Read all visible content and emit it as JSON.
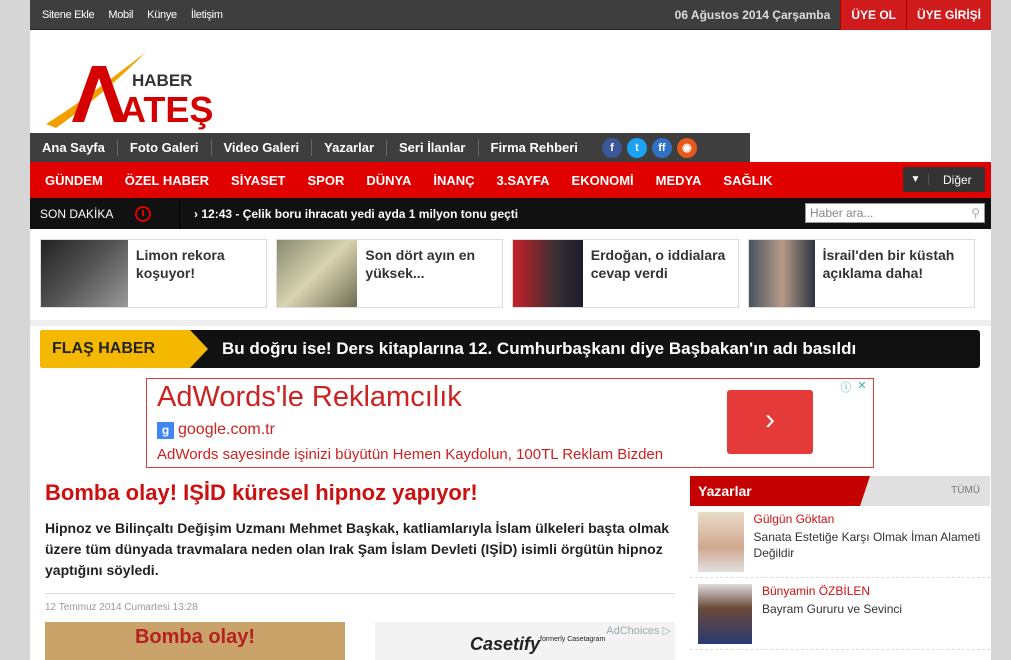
{
  "topbar": {
    "links": [
      "Sitene Ekle",
      "Mobil",
      "Künye",
      "İletişim"
    ],
    "date": "06 Ağustos 2014 Çarşamba",
    "register": "ÜYE OL",
    "login": "ÜYE GİRİŞİ"
  },
  "logo": {
    "big": "ATEŞİ",
    "small": "HABER"
  },
  "nav_main": [
    "Ana Sayfa",
    "Foto Galeri",
    "Video Galeri",
    "Yazarlar",
    "Seri İlanlar",
    "Firma Rehberi"
  ],
  "social_icons": [
    "facebook-icon",
    "twitter-icon",
    "friendfeed-icon",
    "rss-icon"
  ],
  "nav_categories": [
    "GÜNDEM",
    "ÖZEL HABER",
    "SİYASET",
    "SPOR",
    "DÜNYA",
    "İNANÇ",
    "3.SAYFA",
    "EKONOMİ",
    "MEDYA",
    "SAĞLIK"
  ],
  "more_label": "Diğer",
  "breaking": {
    "label": "SON DAKİKA",
    "time": "12:43",
    "text": "Çelik boru ihracatı yedi ayda 1 milyon tonu geçti"
  },
  "search": {
    "placeholder": "Haber ara..."
  },
  "cards": [
    {
      "title": "Limon rekora koşuyor!"
    },
    {
      "title": "Son dört ayın en yüksek..."
    },
    {
      "title": "Erdoğan, o iddialara cevap verdi"
    },
    {
      "title": "İsrail'den bir küstah açıklama daha!"
    }
  ],
  "flash": {
    "label": "FLAŞ HABER",
    "text": "Bu doğru ise! Ders kitaplarına 12. Cumhurbaşkanı diye Başbakan'ın adı basıldı"
  },
  "ad": {
    "headline": "AdWords'le Reklamcılık",
    "url": "google.com.tr",
    "desc": "AdWords sayesinde işinizi büyütün Hemen Kaydolun, 100TL Reklam Bizden"
  },
  "article": {
    "title": "Bomba olay! IŞİD küresel hipnoz yapıyor!",
    "summary": "Hipnoz ve Bilinçaltı Değişim Uzmanı Mehmet Başkak, katliamlarıyla İslam ülkeleri başta olmak üzere tüm dünyada travmalara neden olan Irak Şam İslam Devleti (IŞİD) isimli örgütün hipnoz yaptığını söyledi.",
    "date": "12 Temmuz 2014 Cumartesi 13:28",
    "image_text": "Bomba olay!"
  },
  "ad2": {
    "brand": "Casetify",
    "sub": "formerly Casetagram",
    "choices": "AdChoices"
  },
  "sidebar": {
    "title": "Yazarlar",
    "all": "TÜMÜ",
    "authors": [
      {
        "name": "Gülgün Göktan",
        "article": "Sanata Estetiğe Karşı Olmak İman Alameti Değildir"
      },
      {
        "name": "Bünyamin ÖZBİLEN",
        "article": "Bayram Gururu ve Sevinci"
      }
    ]
  }
}
